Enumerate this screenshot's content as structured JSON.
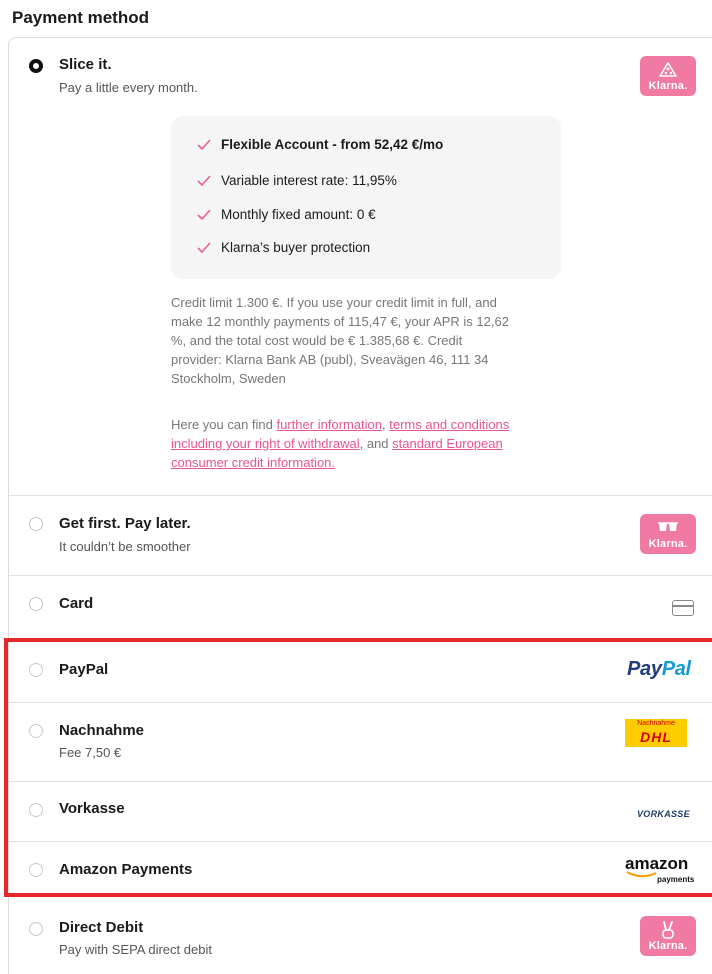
{
  "header": {
    "title": "Payment method"
  },
  "options": {
    "slice": {
      "title": "Slice it.",
      "subtitle": "Pay a little every month.",
      "badge": "Klarna.",
      "benefits": [
        "Flexible Account - from 52,42 €/mo",
        "Variable interest rate: 11,95%",
        "Monthly fixed amount: 0 €",
        "Klarna’s buyer protection"
      ],
      "credit_lines": [
        "Credit limit 1.300 €. If you use your credit limit in full, and",
        "make 12 monthly payments of 115,47 €, your APR is 12,62",
        "%, and the total cost would be € 1.385,68 €. Credit",
        "provider: Klarna Bank AB (publ), Sveavägen 46, 111 34",
        "Stockholm, Sweden"
      ],
      "info_prefix": "Here you can find ",
      "link_further": "further information",
      "sep1": ", ",
      "link_terms_1": "terms and conditions",
      "link_terms_2": "including your right of withdrawal",
      "sep2": ", and ",
      "link_standard_1": "standard European",
      "link_standard_2": "consumer credit information."
    },
    "paylater": {
      "title": "Get first. Pay later.",
      "subtitle": "It couldn’t be smoother",
      "badge": "Klarna."
    },
    "card": {
      "title": "Card"
    },
    "paypal": {
      "title": "PayPal",
      "logo_a": "Pay",
      "logo_b": "Pal"
    },
    "nachnahme": {
      "title": "Nachnahme",
      "subtitle": "Fee 7,50 €",
      "logo_top": "Nachnahme",
      "logo_mark": "DHL"
    },
    "vorkasse": {
      "title": "Vorkasse",
      "logo": "VORKASSE"
    },
    "amazon": {
      "title": "Amazon Payments",
      "logo_word": "amazon",
      "logo_sub": "payments"
    },
    "debit": {
      "title": "Direct Debit",
      "subtitle": "Pay with SEPA direct debit",
      "badge": "Klarna."
    }
  },
  "colors": {
    "klarna_pink": "#f07aa3",
    "highlight": "#e4282b",
    "link": "#e85590"
  }
}
